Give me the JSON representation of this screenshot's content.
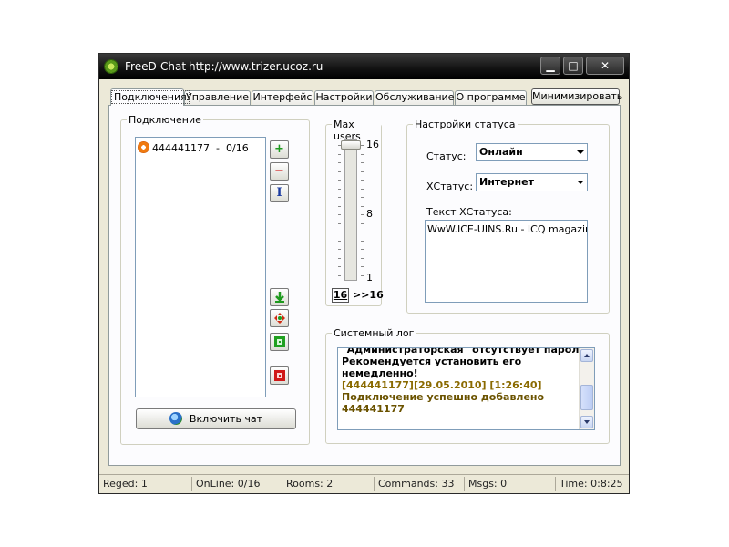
{
  "window": {
    "title": "FreeD-Chat",
    "url": "http://www.trizer.ucoz.ru"
  },
  "titlebar_buttons": {
    "minimize": "▁",
    "maximize": "□",
    "close": "✕"
  },
  "tabs": [
    {
      "label": "Подключения",
      "active": true
    },
    {
      "label": "Управление",
      "active": false
    },
    {
      "label": "Интерфейс",
      "active": false
    },
    {
      "label": "Настройки",
      "active": false
    },
    {
      "label": "Обслуживание",
      "active": false
    },
    {
      "label": "О программе",
      "active": false
    }
  ],
  "minimize_button": "Минимизировать",
  "connections": {
    "legend": "Подключение",
    "items": [
      {
        "uin": "444441177",
        "status": "-",
        "count": "0/16"
      }
    ],
    "side_buttons": {
      "add": "+",
      "remove": "−",
      "rename": "I"
    },
    "connect_button": "Включить чат"
  },
  "max_users": {
    "legend": "Max users",
    "max_label": "16",
    "mid_label": "8",
    "min_label": "1",
    "value": 16,
    "min": 1,
    "max": 16,
    "current": "16",
    "arrow_text": ">>16"
  },
  "status_settings": {
    "legend": "Настройки статуса",
    "status_label": "Статус:",
    "status_value": "Онлайн",
    "xstatus_label": "XСтатус:",
    "xstatus_value": "Интернет",
    "xstatus_text_label": "Текст XСтатуса:",
    "xstatus_text_value": "WwW.ICE-UINS.Ru   - ICQ magazin"
  },
  "system_log": {
    "legend": "Системный лог",
    "lines": [
      {
        "text": "\"Администраторская\" отсутствует пароль!",
        "color": "#000000"
      },
      {
        "text": "Рекомендуется установить его",
        "color": "#000000"
      },
      {
        "text": "немедленно!",
        "color": "#000000"
      },
      {
        "text": "[444441177][29.05.2010] [1:26:40]",
        "color": "#8a6a00"
      },
      {
        "text": "Подключение успешно добавлено",
        "color": "#6b5300"
      },
      {
        "text": "444441177",
        "color": "#6b5300"
      }
    ]
  },
  "statusbar": [
    "Reged: 1",
    "OnLine: 0/16",
    "Rooms: 2",
    "Commands: 33",
    "Msgs: 0",
    "Time: 0:8:25"
  ]
}
